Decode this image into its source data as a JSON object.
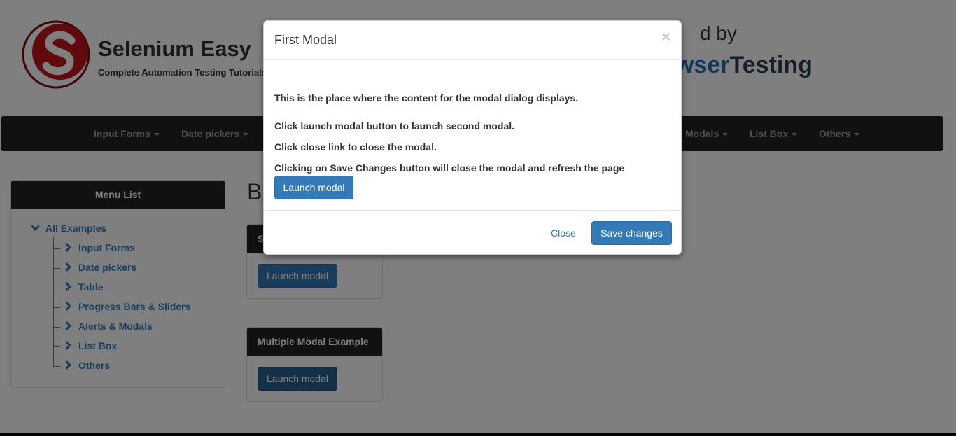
{
  "header": {
    "brand_title": "Selenium Easy",
    "brand_subtitle": "Complete Automation Testing Tutorials",
    "sponsor_prefix": "d by",
    "sponsor_name_part1": "wser",
    "sponsor_name_part2": "Testing"
  },
  "navbar": {
    "items": [
      {
        "label": "Input Forms"
      },
      {
        "label": "Date pickers"
      },
      {
        "label": "Modals"
      },
      {
        "label": "List Box"
      },
      {
        "label": "Others"
      }
    ]
  },
  "sidebar": {
    "title": "Menu List",
    "root": "All Examples",
    "items": [
      {
        "label": "Input Forms"
      },
      {
        "label": "Date pickers"
      },
      {
        "label": "Table"
      },
      {
        "label": "Progress Bars & Sliders"
      },
      {
        "label": "Alerts & Modals"
      },
      {
        "label": "List Box"
      },
      {
        "label": "Others"
      }
    ]
  },
  "main": {
    "heading_fragment": "B",
    "panel_a": {
      "title_fragment": "S",
      "button": "Launch modal"
    },
    "panel_b": {
      "title": "Multiple Modal Example",
      "button": "Launch modal"
    }
  },
  "modal": {
    "title": "First Modal",
    "close_x": "×",
    "body_lines": [
      "This is the place where the content for the modal dialog displays.",
      "Click launch modal button to launch second modal.",
      "Click close link to close the modal.",
      "Clicking on Save Changes button will close the modal and refresh the page"
    ],
    "launch_button": "Launch modal",
    "close_link": "Close",
    "save_button": "Save changes"
  },
  "colors": {
    "primary": "#337ab7",
    "navbar_bg": "#222222",
    "backdrop": "rgba(0,0,0,0.5)"
  }
}
